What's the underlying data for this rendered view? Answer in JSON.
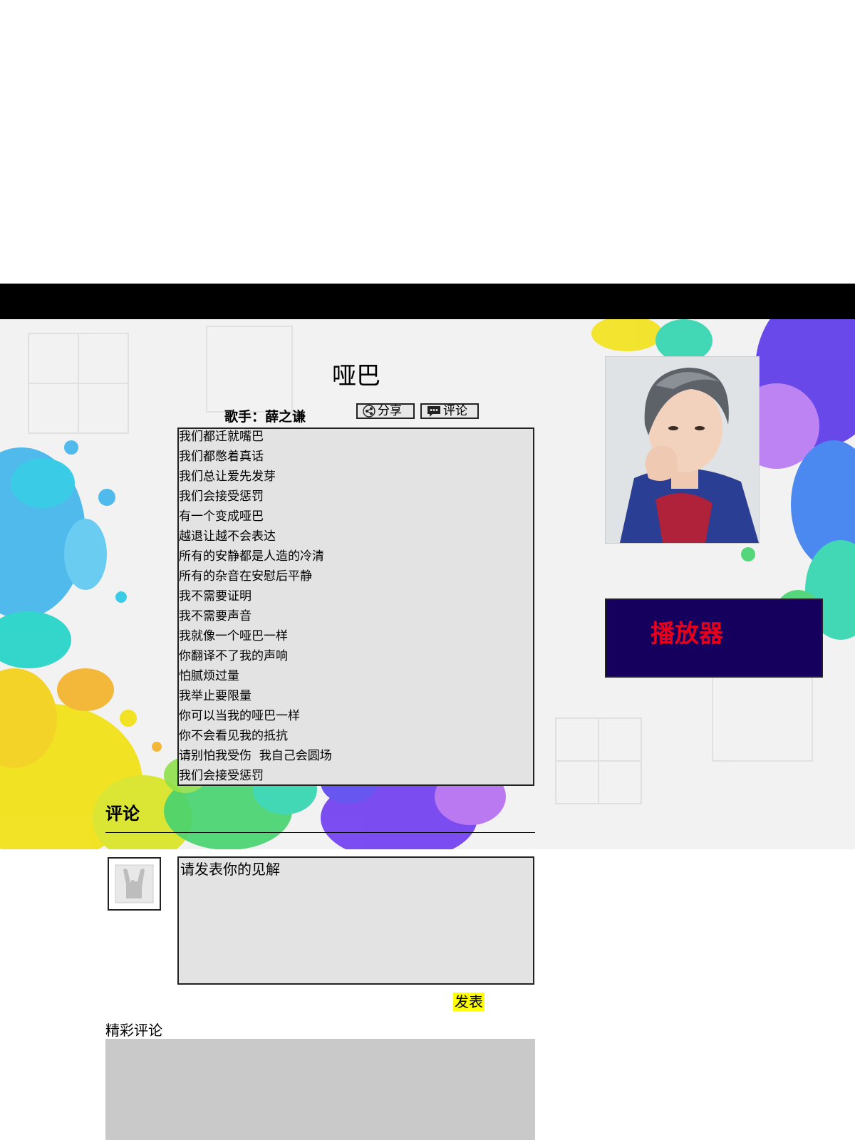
{
  "song": {
    "title": "哑巴",
    "singer": "歌手：薛之谦",
    "share_label": "分享",
    "comment_label": "评论",
    "lyrics": [
      "我们都迁就嘴巴",
      "我们都憋着真话",
      "我们总让爱先发芽",
      "我们会接受惩罚",
      "有一个变成哑巴",
      "越退让越不会表达",
      "所有的安静都是人造的冷清",
      "所有的杂音在安慰后平静",
      "我不需要证明",
      "我不需要声音",
      "我就像一个哑巴一样",
      "你翻译不了我的声响",
      "怕腻烦过量",
      "我举止要限量",
      "你可以当我的哑巴一样",
      "你不会看见我的抵抗",
      "请别怕我受伤  我自己会圆场",
      "我们会接受惩罚"
    ]
  },
  "player": {
    "label": "播放器"
  },
  "comments": {
    "heading": "评论",
    "placeholder": "请发表你的见解",
    "submit_label": "发表",
    "featured_label": "精彩评论"
  },
  "icons": {
    "share": "share-icon",
    "comment": "chat-bubble-icon",
    "avatar": "rock-hand-icon"
  },
  "colors": {
    "topbar": "#000000",
    "player_bg": "#15005e",
    "player_text": "#e6001c",
    "submit_bg": "#ffff00",
    "lyrics_bg": "#e3e3e3"
  }
}
